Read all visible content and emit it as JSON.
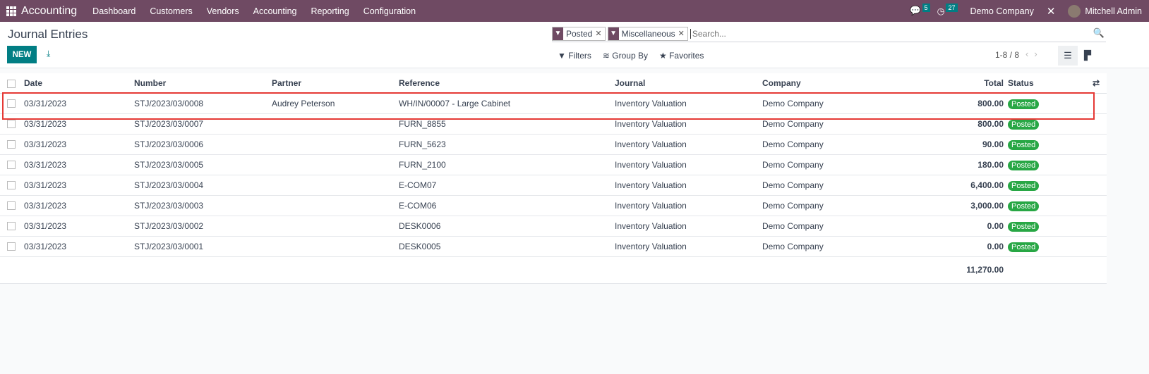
{
  "nav": {
    "app": "Accounting",
    "menus": [
      "Dashboard",
      "Customers",
      "Vendors",
      "Accounting",
      "Reporting",
      "Configuration"
    ],
    "messages_count": "5",
    "activities_count": "27",
    "company": "Demo Company",
    "user": "Mitchell Admin"
  },
  "page": {
    "title": "Journal Entries",
    "new_label": "NEW"
  },
  "search": {
    "facets": [
      "Posted",
      "Miscellaneous"
    ],
    "placeholder": "Search..."
  },
  "tools": {
    "filters": "Filters",
    "group_by": "Group By",
    "favorites": "Favorites"
  },
  "pager": "1-8 / 8",
  "columns": [
    "Date",
    "Number",
    "Partner",
    "Reference",
    "Journal",
    "Company",
    "Total",
    "Status"
  ],
  "rows": [
    [
      "03/31/2023",
      "STJ/2023/03/0008",
      "Audrey Peterson",
      "WH/IN/00007 - Large Cabinet",
      "Inventory Valuation",
      "Demo Company",
      "800.00",
      "Posted"
    ],
    [
      "03/31/2023",
      "STJ/2023/03/0007",
      "",
      "FURN_8855",
      "Inventory Valuation",
      "Demo Company",
      "800.00",
      "Posted"
    ],
    [
      "03/31/2023",
      "STJ/2023/03/0006",
      "",
      "FURN_5623",
      "Inventory Valuation",
      "Demo Company",
      "90.00",
      "Posted"
    ],
    [
      "03/31/2023",
      "STJ/2023/03/0005",
      "",
      "FURN_2100",
      "Inventory Valuation",
      "Demo Company",
      "180.00",
      "Posted"
    ],
    [
      "03/31/2023",
      "STJ/2023/03/0004",
      "",
      "E-COM07",
      "Inventory Valuation",
      "Demo Company",
      "6,400.00",
      "Posted"
    ],
    [
      "03/31/2023",
      "STJ/2023/03/0003",
      "",
      "E-COM06",
      "Inventory Valuation",
      "Demo Company",
      "3,000.00",
      "Posted"
    ],
    [
      "03/31/2023",
      "STJ/2023/03/0002",
      "",
      "DESK0006",
      "Inventory Valuation",
      "Demo Company",
      "0.00",
      "Posted"
    ],
    [
      "03/31/2023",
      "STJ/2023/03/0001",
      "",
      "DESK0005",
      "Inventory Valuation",
      "Demo Company",
      "0.00",
      "Posted"
    ]
  ],
  "total_sum": "11,270.00",
  "colors": {
    "navbar": "#6f4a63",
    "primary": "#017e84",
    "posted": "#28a745",
    "highlight": "#e53935"
  }
}
